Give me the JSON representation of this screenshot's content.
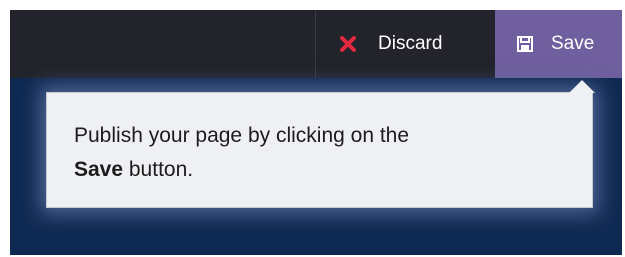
{
  "toolbar": {
    "discard_label": "Discard",
    "save_label": "Save",
    "discard_icon": "close-icon",
    "save_icon": "floppy-disk-icon",
    "discard_icon_color": "#e0283f",
    "save_bg_color": "#6f5f9e"
  },
  "tooltip": {
    "text_before": "Publish your page by clicking on the",
    "bold": "Save",
    "text_after": " button."
  }
}
